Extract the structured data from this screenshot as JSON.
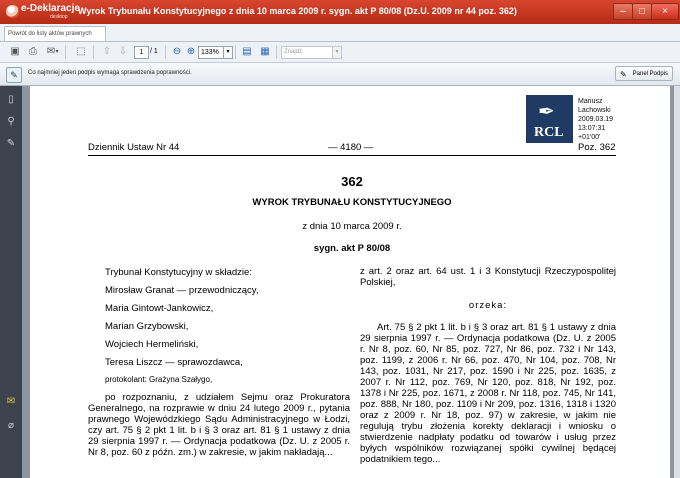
{
  "window": {
    "app_logo": "e-Deklaracje",
    "app_logo_sub": "desktop",
    "title": "Wyrok Trybunału Konstytucyjnego z dnia 10 marca 2009 r. sygn. akt P 80/08 (Dz.U. 2009 nr 44 poz. 362)",
    "minimize": "–",
    "maximize": "□",
    "close": "×"
  },
  "tab": {
    "back_label": "Powrót do listy aktów prawnych"
  },
  "toolbar": {
    "page_current": "1",
    "page_total": "/ 1",
    "zoom": "133%",
    "find_placeholder": "Znajdź"
  },
  "message": {
    "text": "Co najmniej jeden podpis wymaga sprawdzenia poprawności.",
    "panel_button": "Panel Podpis"
  },
  "signature": {
    "logo_text": "RCL",
    "lines": [
      "Mariusz",
      "Lachowski",
      "2009.03.19",
      "13:07:31",
      "+01'00'"
    ]
  },
  "document": {
    "header_left": "Dziennik Ustaw Nr 44",
    "header_center": "— 4180 —",
    "header_right": "Poz. 362",
    "number": "362",
    "heading": "WYROK TRYBUNAŁU KONSTYTUCYJNEGO",
    "date": "z dnia 10 marca 2009 r.",
    "signature_ref": "sygn. akt P 80/08",
    "left": {
      "composition": "Trybunał Konstytucyjny w składzie:",
      "judges": [
        "Mirosław Granat — przewodniczący,",
        "Maria Gintowt-Jankowicz,",
        "Marian Grzybowski,",
        "Wojciech Hermeliński,",
        "Teresa Liszcz — sprawozdawca,"
      ],
      "protocol": "protokolant: Grażyna Szałygo,",
      "paragraph": "po rozpoznaniu, z udziałem Sejmu oraz Prokuratora Generalnego, na rozprawie w dniu 24 lutego 2009 r., pytania prawnego Wojewódzkiego Sądu Administracyjnego w Łodzi, czy art. 75 § 2 pkt 1 lit. b i § 3 oraz art. 81 § 1 ustawy z dnia 29 sierpnia 1997 r. — Ordynacja podatkowa (Dz. U. z 2005 r. Nr 8, poz. 60 z późn. zm.) w zakresie, w jakim nakładają..."
    },
    "right": {
      "intro": "z art. 2 oraz art. 64 ust. 1 i 3 Konstytucji Rzeczypospolitej Polskiej,",
      "ruling": "orzeka:",
      "paragraph": "Art. 75 § 2 pkt 1 lit. b i § 3 oraz art. 81 § 1 ustawy z dnia 29 sierpnia 1997 r. — Ordynacja podatkowa (Dz. U. z 2005 r. Nr 8, poz. 60, Nr 85, poz. 727, Nr 86, poz. 732 i Nr 143, poz. 1199, z 2006 r. Nr 66, poz. 470, Nr 104, poz. 708, Nr 143, poz. 1031, Nr 217, poz. 1590 i Nr 225, poz. 1635, z 2007 r. Nr 112, poz. 769, Nr 120, poz. 818, Nr 192, poz. 1378 i Nr 225, poz. 1671, z 2008 r. Nr 118, poz. 745, Nr 141, poz. 888, Nr 180, poz. 1109 i Nr 209, poz. 1316, 1318 i 1320 oraz z 2009 r. Nr 18, poz. 97) w zakresie, w jakim nie regulują trybu złożenia korekty deklaracji i wniosku o stwierdzenie nadpłaty podatku od towarów i usług przez byłych wspólników rozwiązanej spółki cywilnej będącej podatnikiem tego..."
    }
  }
}
